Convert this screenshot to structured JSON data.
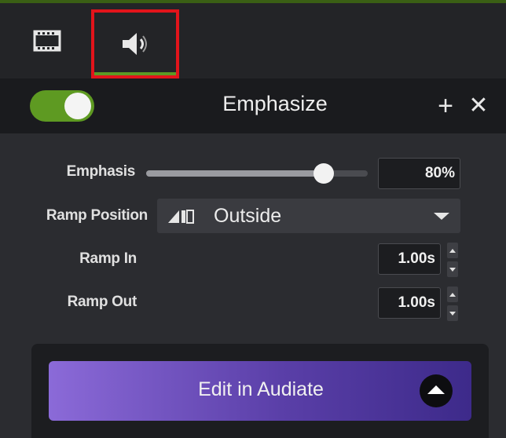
{
  "tabs": [
    {
      "icon": "film-strip-icon",
      "active": false
    },
    {
      "icon": "speaker-icon",
      "active": true
    }
  ],
  "effect": {
    "enabled": true,
    "title": "Emphasize",
    "add_label": "+",
    "close_label": "✕"
  },
  "properties": {
    "emphasis_label": "Emphasis",
    "emphasis_value": "80%",
    "emphasis_level": 0.8,
    "ramp_position_label": "Ramp Position",
    "ramp_position_value": "Outside",
    "ramp_in_label": "Ramp In",
    "ramp_in_value": "1.00s",
    "ramp_out_label": "Ramp Out",
    "ramp_out_value": "1.00s"
  },
  "audiate": {
    "button_label": "Edit in Audiate"
  },
  "colors": {
    "accent_green": "#5e9a22",
    "highlight_red": "#e2141b",
    "audiate_purple": "#6b4fc2"
  }
}
